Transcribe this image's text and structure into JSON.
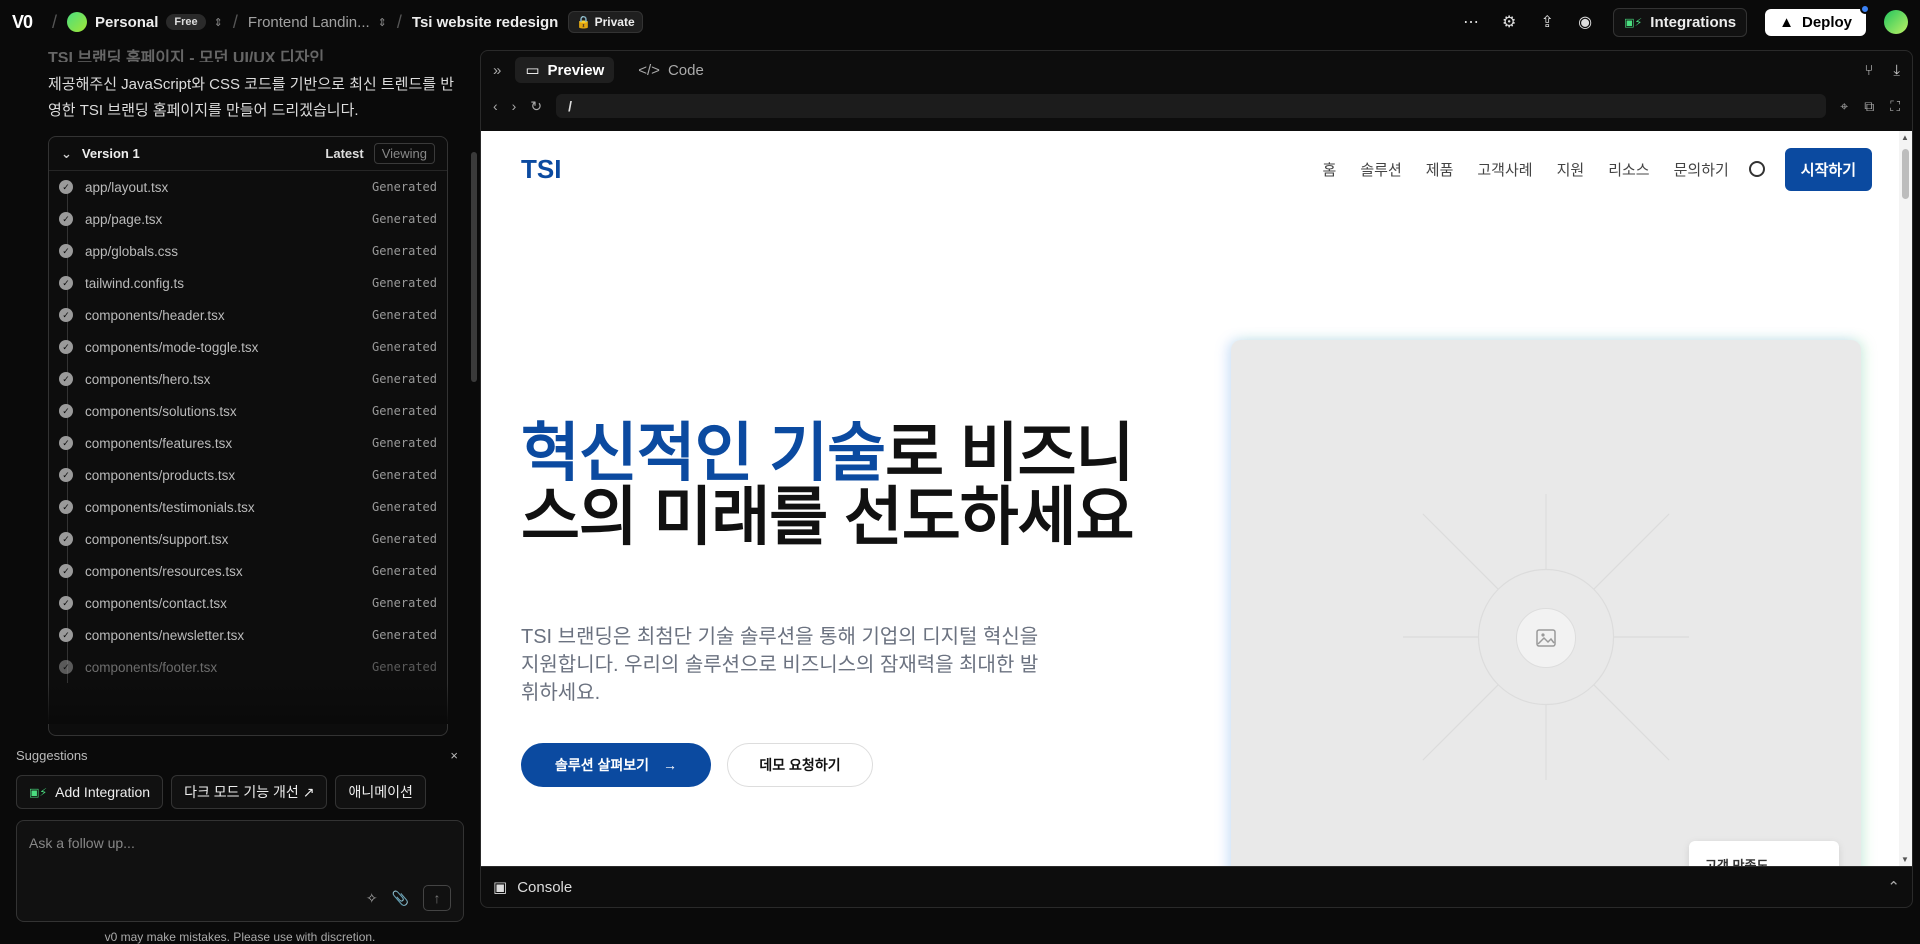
{
  "topbar": {
    "logo": "V0",
    "workspace": "Personal",
    "plan_badge": "Free",
    "project": "Frontend Landin...",
    "chat_title": "Tsi website redesign",
    "visibility": "Private",
    "integrations_label": "Integrations",
    "deploy_label": "Deploy"
  },
  "chat": {
    "faded_message": "TSI 브랜딩 홈페이지 - 모던 UI/UX 디자인",
    "message": "제공해주신 JavaScript와 CSS 코드를 기반으로 최신 트렌드를 반영한 TSI 브랜딩 홈페이지를 만들어 드리겠습니다.",
    "version": {
      "title": "Version 1",
      "latest": "Latest",
      "viewing": "Viewing",
      "files": [
        {
          "name": "app/layout.tsx",
          "status": "Generated"
        },
        {
          "name": "app/page.tsx",
          "status": "Generated"
        },
        {
          "name": "app/globals.css",
          "status": "Generated"
        },
        {
          "name": "tailwind.config.ts",
          "status": "Generated"
        },
        {
          "name": "components/header.tsx",
          "status": "Generated"
        },
        {
          "name": "components/mode-toggle.tsx",
          "status": "Generated"
        },
        {
          "name": "components/hero.tsx",
          "status": "Generated"
        },
        {
          "name": "components/solutions.tsx",
          "status": "Generated"
        },
        {
          "name": "components/features.tsx",
          "status": "Generated"
        },
        {
          "name": "components/products.tsx",
          "status": "Generated"
        },
        {
          "name": "components/testimonials.tsx",
          "status": "Generated"
        },
        {
          "name": "components/support.tsx",
          "status": "Generated"
        },
        {
          "name": "components/resources.tsx",
          "status": "Generated"
        },
        {
          "name": "components/contact.tsx",
          "status": "Generated"
        },
        {
          "name": "components/newsletter.tsx",
          "status": "Generated"
        },
        {
          "name": "components/footer.tsx",
          "status": "Generated"
        }
      ]
    }
  },
  "suggestions": {
    "title": "Suggestions",
    "close": "×",
    "chips": [
      "Add Integration",
      "다크 모드 기능 개선 ↗",
      "애니메이션"
    ]
  },
  "followup": {
    "placeholder": "Ask a follow up..."
  },
  "disclaimer": "v0 may make mistakes. Please use with discretion.",
  "preview_panel": {
    "tab_preview": "Preview",
    "tab_code": "Code",
    "url": "/",
    "console_label": "Console"
  },
  "site": {
    "logo": "TSI",
    "nav": [
      "홈",
      "솔루션",
      "제품",
      "고객사례",
      "지원",
      "리소스",
      "문의하기"
    ],
    "cta": "시작하기",
    "hero_title_highlight": "혁신적인 기술",
    "hero_title_rest": "로 비즈니스의 미래를 선도하세요",
    "hero_subtitle": "TSI 브랜딩은 최첨단 기술 솔루션을 통해 기업의 디지털 혁신을 지원합니다. 우리의 솔루션으로 비즈니스의 잠재력을 최대한 발휘하세요.",
    "primary_button": "솔루션 살펴보기",
    "secondary_button": "데모 요청하기",
    "floating_card": "고객 만족도"
  }
}
